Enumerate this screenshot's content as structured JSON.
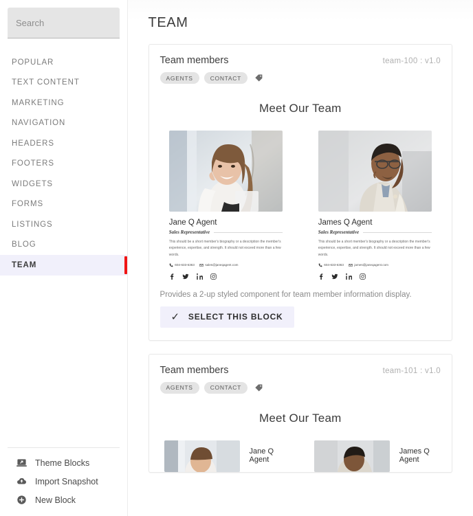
{
  "sidebar": {
    "search": {
      "placeholder": "Search",
      "value": ""
    },
    "items": [
      {
        "label": "POPULAR",
        "active": false
      },
      {
        "label": "TEXT CONTENT",
        "active": false
      },
      {
        "label": "MARKETING",
        "active": false
      },
      {
        "label": "NAVIGATION",
        "active": false
      },
      {
        "label": "HEADERS",
        "active": false
      },
      {
        "label": "FOOTERS",
        "active": false
      },
      {
        "label": "WIDGETS",
        "active": false
      },
      {
        "label": "FORMS",
        "active": false
      },
      {
        "label": "LISTINGS",
        "active": false
      },
      {
        "label": "BLOG",
        "active": false
      },
      {
        "label": "TEAM",
        "active": true
      }
    ],
    "footer_items": [
      {
        "label": "Theme Blocks",
        "icon": "theme-blocks-icon"
      },
      {
        "label": "Import Snapshot",
        "icon": "cloud-upload-icon"
      },
      {
        "label": "New Block",
        "icon": "plus-circle-icon"
      }
    ],
    "active_accent_color": "#f01414",
    "active_background_color": "#f1f0fb"
  },
  "main": {
    "page_title": "TEAM",
    "blocks": [
      {
        "title": "Team members",
        "version": "team-100 : v1.0",
        "chips": [
          "AGENTS",
          "CONTACT"
        ],
        "tag_icon": "tag-icon",
        "preview": {
          "heading": "Meet Our Team",
          "layout": "stacked",
          "members": [
            {
              "name": "Jane Q Agent",
              "role": "Sales Representative",
              "bio": "This should be a short member's biography or a description the member's experience, expertise, and strength. It should not exceed more than a few words.",
              "phone": "604-633-6363",
              "email": "sales@janeqagent.com",
              "social": [
                "facebook-icon",
                "twitter-icon",
                "linkedin-icon",
                "instagram-icon"
              ]
            },
            {
              "name": "James Q Agent",
              "role": "Sales Representative",
              "bio": "This should be a short member's biography or a description the member's experience, expertise, and strength. It should not exceed more than a few words.",
              "phone": "604-633-6363",
              "email": "james@janeqagent.com",
              "social": [
                "facebook-icon",
                "twitter-icon",
                "linkedin-icon",
                "instagram-icon"
              ]
            }
          ]
        },
        "description": "Provides a 2-up styled component for team member information display.",
        "select_label": "SELECT THIS BLOCK",
        "select_icon": "check-icon"
      },
      {
        "title": "Team members",
        "version": "team-101 : v1.0",
        "chips": [
          "AGENTS",
          "CONTACT"
        ],
        "tag_icon": "tag-icon",
        "preview": {
          "heading": "Meet Our Team",
          "layout": "inline",
          "members": [
            {
              "name": "Jane Q Agent"
            },
            {
              "name": "James Q Agent"
            }
          ]
        }
      }
    ]
  }
}
